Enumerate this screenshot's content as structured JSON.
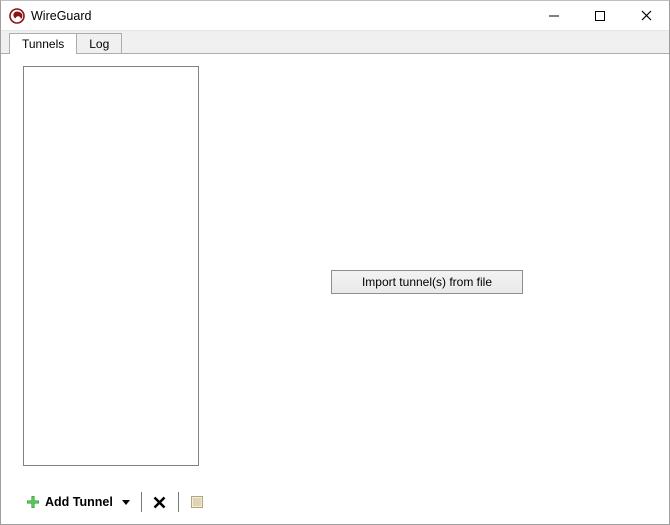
{
  "window": {
    "title": "WireGuard"
  },
  "tabs": {
    "tunnels": "Tunnels",
    "log": "Log"
  },
  "main": {
    "import_button": "Import tunnel(s) from file"
  },
  "toolbar": {
    "add_tunnel": "Add Tunnel"
  },
  "icons": {
    "app": "wireguard-logo",
    "minimize": "minimize-icon",
    "maximize": "maximize-icon",
    "close": "close-icon",
    "add": "plus-icon",
    "dropdown": "chevron-down-icon",
    "delete": "x-icon",
    "export": "export-icon"
  }
}
